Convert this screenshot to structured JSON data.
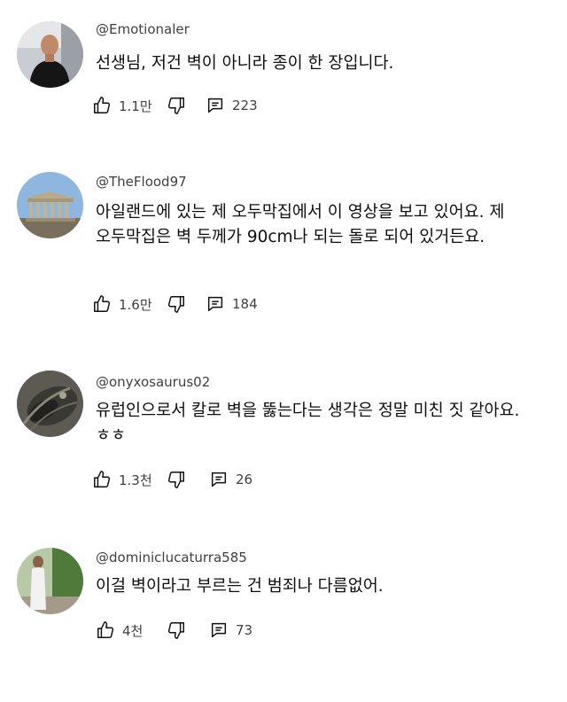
{
  "comments": [
    {
      "handle": "@Emotionaler",
      "text": "선생님, 저건 벽이 아니라 종이 한 장입니다.",
      "likes": "1.1만",
      "replies": "223",
      "avatar": "person-black-shirt"
    },
    {
      "handle": "@TheFlood97",
      "text": "아일랜드에 있는 제 오두막집에서 이 영상을 보고 있어요. 제 오두막집은 벽 두께가 90cm나 되는 돌로 되어 있거든요.",
      "likes": "1.6만",
      "replies": "184",
      "avatar": "parthenon"
    },
    {
      "handle": "@onyxosaurus02",
      "text": "유럽인으로서 칼로 벽을 뚫는다는 생각은 정말 미친 짓 같아요. ㅎㅎ",
      "likes": "1.3천",
      "replies": "26",
      "avatar": "dark-creature"
    },
    {
      "handle": "@dominiclucaturra585",
      "text": "이걸 벽이라고 부르는 건 범죄나 다름없어.",
      "likes": "4천",
      "replies": "73",
      "avatar": "person-white-outfit"
    }
  ],
  "colors": {
    "text": "#0f0f0f",
    "secondary": "#3f3f3f",
    "icon": "#0f0f0f",
    "background": "#ffffff"
  },
  "icons": [
    "thumbs-up-icon",
    "thumbs-down-icon",
    "reply-icon"
  ]
}
